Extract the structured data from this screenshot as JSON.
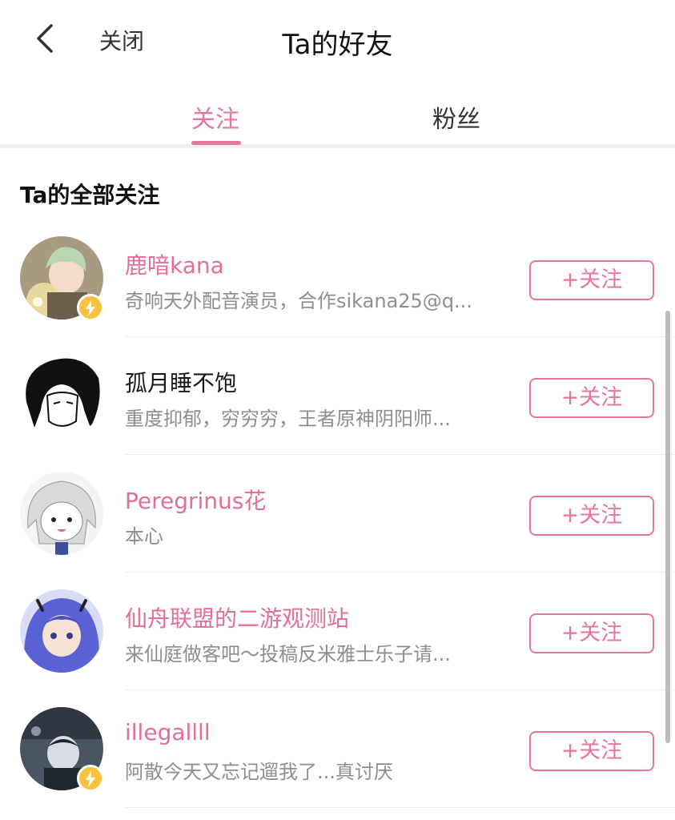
{
  "header": {
    "close_label": "关闭",
    "title": "Ta的好友"
  },
  "tabs": [
    {
      "label": "关注",
      "active": true
    },
    {
      "label": "粉丝",
      "active": false
    }
  ],
  "section_title": "Ta的全部关注",
  "follow_button_label": "+关注",
  "colors": {
    "accent": "#e8769c",
    "name_pink": "#e36e96",
    "badge": "#f8c240"
  },
  "users": [
    {
      "name": "鹿喑kana",
      "desc": "奇响天外配音演员，合作sikana25@q...",
      "name_color": "pink",
      "verified": true,
      "avatar_icon": "avatar-green-hair-boy"
    },
    {
      "name": "孤月睡不饱",
      "desc": "重度抑郁，穷穷穷，王者原神阴阳师...",
      "name_color": "dark",
      "verified": false,
      "avatar_icon": "avatar-black-hair-sketch"
    },
    {
      "name": "Peregrinus花",
      "desc": "本心",
      "name_color": "pink",
      "verified": false,
      "avatar_icon": "avatar-white-hair-chibi"
    },
    {
      "name": "仙舟联盟的二游观测站",
      "desc": "来仙庭做客吧～投稿反米雅士乐子请...",
      "name_color": "pink",
      "verified": false,
      "avatar_icon": "avatar-blue-hair-horns"
    },
    {
      "name": "illegallll",
      "desc": "阿散今天又忘记遛我了...真讨厌",
      "name_color": "pink",
      "verified": true,
      "avatar_icon": "avatar-dark-figure"
    }
  ]
}
